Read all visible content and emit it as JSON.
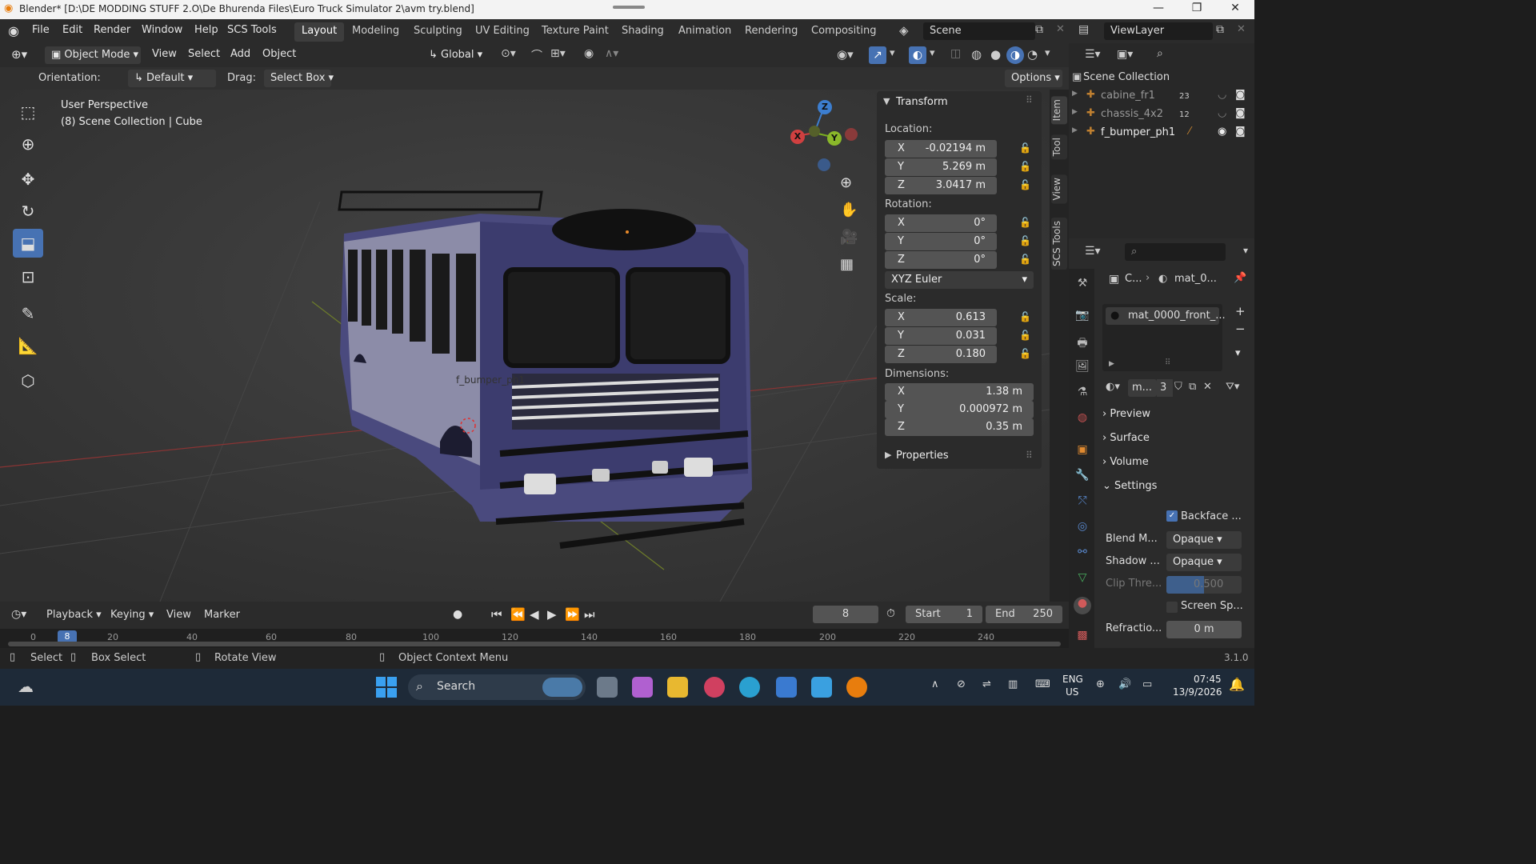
{
  "titlebar": {
    "title": "Blender* [D:\\DE MODDING STUFF 2.O\\De Bhurenda Files\\Euro Truck Simulator 2\\avm try.blend]"
  },
  "menu": [
    "File",
    "Edit",
    "Render",
    "Window",
    "Help",
    "SCS Tools"
  ],
  "workspaces": [
    "Layout",
    "Modeling",
    "Sculpting",
    "UV Editing",
    "Texture Paint",
    "Shading",
    "Animation",
    "Rendering",
    "Compositing"
  ],
  "scene": {
    "label": "Scene",
    "viewlayer": "ViewLayer"
  },
  "viewport_header": {
    "mode": "Object Mode",
    "view": "View",
    "select": "Select",
    "add": "Add",
    "object": "Object",
    "transform_orientation": "Global",
    "orientation_label": "Orientation:",
    "orientation_value": "Default",
    "drag_label": "Drag:",
    "drag_value": "Select Box",
    "options": "Options"
  },
  "viewport": {
    "perspective": "User Perspective",
    "context": "(8) Scene Collection | Cube",
    "object_label": "f_bumper_ph1",
    "gizmo": {
      "x": "X",
      "y": "Y",
      "z": "Z"
    }
  },
  "npanel": {
    "title": "Transform",
    "location_label": "Location:",
    "location": {
      "x": "-0.02194 m",
      "y": "5.269 m",
      "z": "3.0417 m"
    },
    "rotation_label": "Rotation:",
    "rotation": {
      "x": "0°",
      "y": "0°",
      "z": "0°"
    },
    "rotation_mode": "XYZ Euler",
    "scale_label": "Scale:",
    "scale": {
      "x": "0.613",
      "y": "0.031",
      "z": "0.180"
    },
    "dimensions_label": "Dimensions:",
    "dimensions": {
      "x": "1.38 m",
      "y": "0.000972 m",
      "z": "0.35 m"
    },
    "properties": "Properties",
    "axis": {
      "x": "X",
      "y": "Y",
      "z": "Z"
    }
  },
  "sidetabs": [
    "Item",
    "Tool",
    "View",
    "SCS Tools"
  ],
  "outliner": {
    "root": "Scene Collection",
    "items": [
      {
        "name": "cabine_fr1",
        "count": "23"
      },
      {
        "name": "chassis_4x2",
        "count": "12"
      },
      {
        "name": "f_bumper_ph1",
        "count": ""
      }
    ]
  },
  "properties": {
    "breadcrumb_obj": "C...",
    "breadcrumb_mat": "mat_0...",
    "slot": "mat_0000_front_...",
    "material_short": "m...",
    "users": "3",
    "sections": [
      "Preview",
      "Surface",
      "Volume",
      "Settings"
    ],
    "backface": "Backface ...",
    "blend_label": "Blend M...",
    "blend_value": "Opaque",
    "shadow_label": "Shadow ...",
    "shadow_value": "Opaque",
    "clip_label": "Clip Thre...",
    "clip_value": "0.500",
    "screen_space": "Screen Sp...",
    "refraction_label": "Refractio...",
    "refraction_value": "0 m"
  },
  "timeline": {
    "playback": "Playback",
    "keying": "Keying",
    "view": "View",
    "marker": "Marker",
    "current_frame": "8",
    "start_label": "Start",
    "start": "1",
    "end_label": "End",
    "end": "250",
    "ticks": [
      "0",
      "8",
      "20",
      "40",
      "60",
      "80",
      "100",
      "120",
      "140",
      "160",
      "180",
      "200",
      "220",
      "240"
    ]
  },
  "statusbar": {
    "select": "Select",
    "box_select": "Box Select",
    "rotate": "Rotate View",
    "context_menu": "Object Context Menu",
    "version": "3.1.0"
  },
  "taskbar": {
    "search": "Search",
    "lang1": "ENG",
    "lang2": "US",
    "time": "07:45",
    "date": "13/9/2026"
  },
  "colors": {
    "accent": "#4772b3",
    "bus_body": "#4a4a7e",
    "header": "#2b2b2b",
    "viewport": "#3a3a3a"
  }
}
